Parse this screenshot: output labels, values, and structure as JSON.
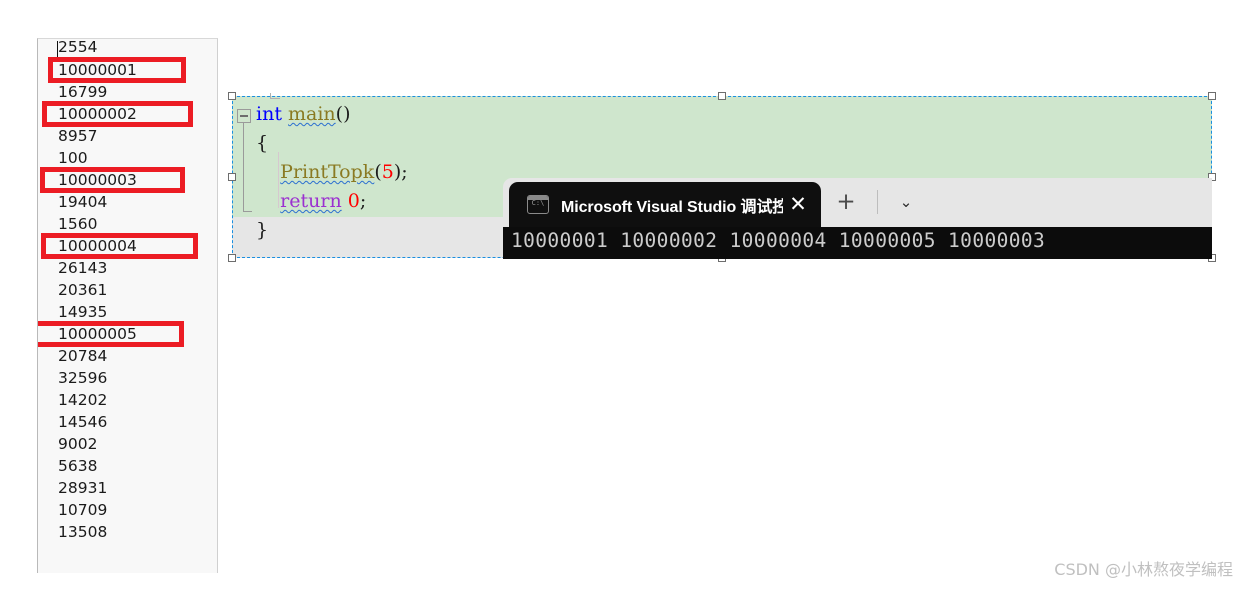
{
  "numbers_panel": {
    "name": "array-values-list",
    "rows": [
      {
        "value": "2554",
        "highlighted": false
      },
      {
        "value": "10000001",
        "highlighted": true
      },
      {
        "value": "16799",
        "highlighted": false
      },
      {
        "value": "10000002",
        "highlighted": true
      },
      {
        "value": "8957",
        "highlighted": false
      },
      {
        "value": "100",
        "highlighted": false
      },
      {
        "value": "10000003",
        "highlighted": true
      },
      {
        "value": "19404",
        "highlighted": false
      },
      {
        "value": "1560",
        "highlighted": false
      },
      {
        "value": "10000004",
        "highlighted": true
      },
      {
        "value": "26143",
        "highlighted": false
      },
      {
        "value": "20361",
        "highlighted": false
      },
      {
        "value": "14935",
        "highlighted": false
      },
      {
        "value": "10000005",
        "highlighted": true
      },
      {
        "value": "20784",
        "highlighted": false
      },
      {
        "value": "32596",
        "highlighted": false
      },
      {
        "value": "14202",
        "highlighted": false
      },
      {
        "value": "14546",
        "highlighted": false
      },
      {
        "value": "9002",
        "highlighted": false
      },
      {
        "value": "5638",
        "highlighted": false
      },
      {
        "value": "28931",
        "highlighted": false
      },
      {
        "value": "10709",
        "highlighted": false
      },
      {
        "value": "13508",
        "highlighted": false
      }
    ],
    "highlight_color": "#ec1c24"
  },
  "code_editor": {
    "background_color": "#cfe6cd",
    "collapse_icon": "minus-collapse-icon",
    "lines": [
      {
        "id": "line-main-signature",
        "tokens": [
          {
            "text": "int",
            "type": "keyword"
          },
          {
            "text": " ",
            "type": "plain"
          },
          {
            "text": "main",
            "type": "function",
            "squiggly": true
          },
          {
            "text": "()",
            "type": "plain"
          }
        ]
      },
      {
        "id": "line-open-brace",
        "tokens": [
          {
            "text": "{",
            "type": "plain"
          }
        ]
      },
      {
        "id": "line-printtopk-call",
        "tokens": [
          {
            "text": "    ",
            "type": "plain"
          },
          {
            "text": "PrintTopk",
            "type": "function",
            "squiggly": true
          },
          {
            "text": "(",
            "type": "plain"
          },
          {
            "text": "5",
            "type": "number"
          },
          {
            "text": ")",
            "type": "plain"
          },
          {
            "text": ";",
            "type": "plain"
          }
        ]
      },
      {
        "id": "line-return",
        "tokens": [
          {
            "text": "    ",
            "type": "plain"
          },
          {
            "text": "return",
            "type": "return-keyword",
            "squiggly": true
          },
          {
            "text": " ",
            "type": "plain"
          },
          {
            "text": "0",
            "type": "number"
          },
          {
            "text": ";",
            "type": "plain"
          }
        ]
      },
      {
        "id": "line-close-brace",
        "tokens": [
          {
            "text": "}",
            "type": "plain"
          }
        ]
      }
    ],
    "selection": {
      "border_color": "#1a8fe0",
      "handle_count": 6
    }
  },
  "terminal": {
    "tab": {
      "icon": "command-prompt-icon",
      "title": "Microsoft Visual Studio 调试控",
      "close_label": "✕"
    },
    "new_tab_label": "+",
    "dropdown_label": "⌄",
    "console_output": "10000001 10000002 10000004 10000005 10000003",
    "background_color": "#0c0c0c",
    "tabbar_color": "#e6e6e6"
  },
  "watermark": {
    "text": "CSDN @小林熬夜学编程"
  }
}
